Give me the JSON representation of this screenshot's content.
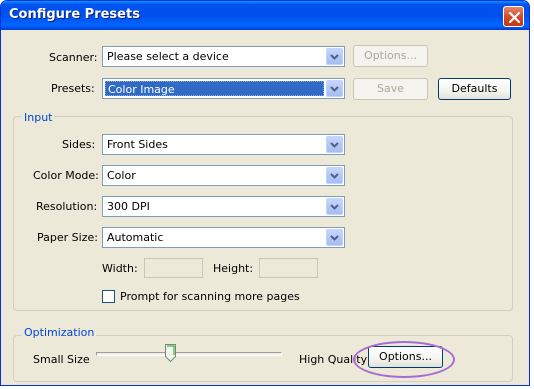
{
  "window": {
    "title": "Configure Presets"
  },
  "scanner": {
    "label": "Scanner:",
    "value": "Please select a device",
    "options_button": "Options..."
  },
  "presets": {
    "label": "Presets:",
    "value": "Color Image",
    "save_button": "Save",
    "defaults_button": "Defaults"
  },
  "input_group": {
    "legend": "Input",
    "sides": {
      "label": "Sides:",
      "value": "Front Sides"
    },
    "color_mode": {
      "label": "Color Mode:",
      "value": "Color"
    },
    "resolution": {
      "label": "Resolution:",
      "value": "300 DPI"
    },
    "paper_size": {
      "label": "Paper Size:",
      "value": "Automatic"
    },
    "width": {
      "label": "Width:",
      "value": ""
    },
    "height": {
      "label": "Height:",
      "value": ""
    },
    "prompt_checkbox": {
      "label": "Prompt for scanning more pages",
      "checked": false
    }
  },
  "optimization_group": {
    "legend": "Optimization",
    "min_label": "Small Size",
    "max_label": "High Quality",
    "options_button": "Options...",
    "slider_level": 0.4
  },
  "colors": {
    "titlebar": "#0054e3",
    "selection": "#316ac5",
    "highlight_ring": "#a86ad8",
    "group_legend": "#0046d5"
  }
}
